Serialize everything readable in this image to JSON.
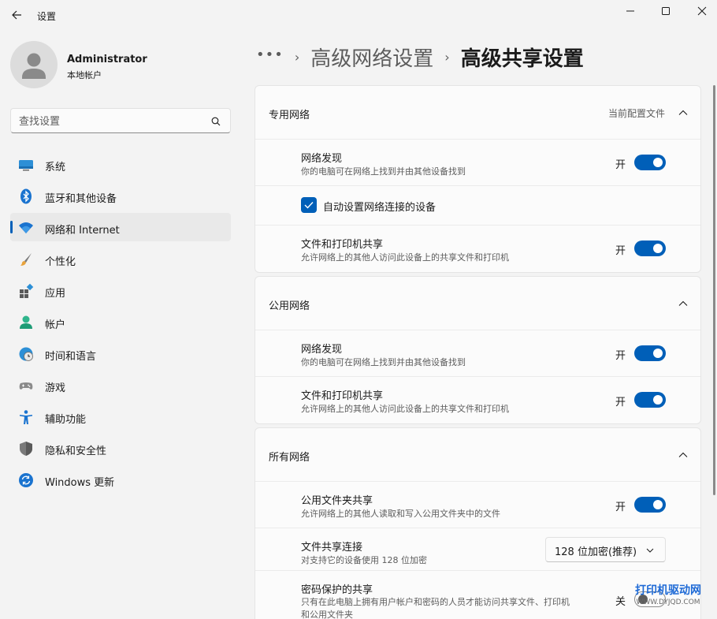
{
  "window": {
    "title": "设置"
  },
  "profile": {
    "name": "Administrator",
    "account_type": "本地帐户"
  },
  "search": {
    "placeholder": "查找设置"
  },
  "sidebar": {
    "items": [
      {
        "label": "系统",
        "icon": "system-icon"
      },
      {
        "label": "蓝牙和其他设备",
        "icon": "bluetooth-icon"
      },
      {
        "label": "网络和 Internet",
        "icon": "wifi-icon",
        "active": true
      },
      {
        "label": "个性化",
        "icon": "brush-icon"
      },
      {
        "label": "应用",
        "icon": "apps-icon"
      },
      {
        "label": "帐户",
        "icon": "account-icon"
      },
      {
        "label": "时间和语言",
        "icon": "globe-clock-icon"
      },
      {
        "label": "游戏",
        "icon": "gamepad-icon"
      },
      {
        "label": "辅助功能",
        "icon": "accessibility-icon"
      },
      {
        "label": "隐私和安全性",
        "icon": "shield-icon"
      },
      {
        "label": "Windows 更新",
        "icon": "update-icon"
      }
    ]
  },
  "breadcrumb": {
    "more": "•••",
    "parent": "高级网络设置",
    "current": "高级共享设置"
  },
  "sections": {
    "private": {
      "title": "专用网络",
      "status": "当前配置文件",
      "discovery": {
        "title": "网络发现",
        "desc": "你的电脑可在网络上找到并由其他设备找到",
        "state": "开",
        "on": true
      },
      "auto_setup": {
        "label": "自动设置网络连接的设备",
        "checked": true
      },
      "file_print": {
        "title": "文件和打印机共享",
        "desc": "允许网络上的其他人访问此设备上的共享文件和打印机",
        "state": "开",
        "on": true
      }
    },
    "public": {
      "title": "公用网络",
      "discovery": {
        "title": "网络发现",
        "desc": "你的电脑可在网络上找到并由其他设备找到",
        "state": "开",
        "on": true
      },
      "file_print": {
        "title": "文件和打印机共享",
        "desc": "允许网络上的其他人访问此设备上的共享文件和打印机",
        "state": "开",
        "on": true
      }
    },
    "all": {
      "title": "所有网络",
      "public_folder": {
        "title": "公用文件夹共享",
        "desc": "允许网络上的其他人读取和写入公用文件夹中的文件",
        "state": "开",
        "on": true
      },
      "file_sharing_conn": {
        "title": "文件共享连接",
        "desc": "对支持它的设备使用 128 位加密",
        "selected": "128 位加密(推荐)"
      },
      "password_sharing": {
        "title": "密码保护的共享",
        "desc_line1": "只有在此电脑上拥有用户帐户和密码的人员才能访问共享文件、打印机",
        "desc_line2": "和公用文件夹",
        "state": "关",
        "on": false
      }
    }
  },
  "watermark": {
    "main": "打印机驱动网",
    "sub": "WWW.DYJQD.COM"
  },
  "colors": {
    "accent": "#005fb8",
    "background": "#f3f3f3",
    "card": "#fbfbfb"
  }
}
